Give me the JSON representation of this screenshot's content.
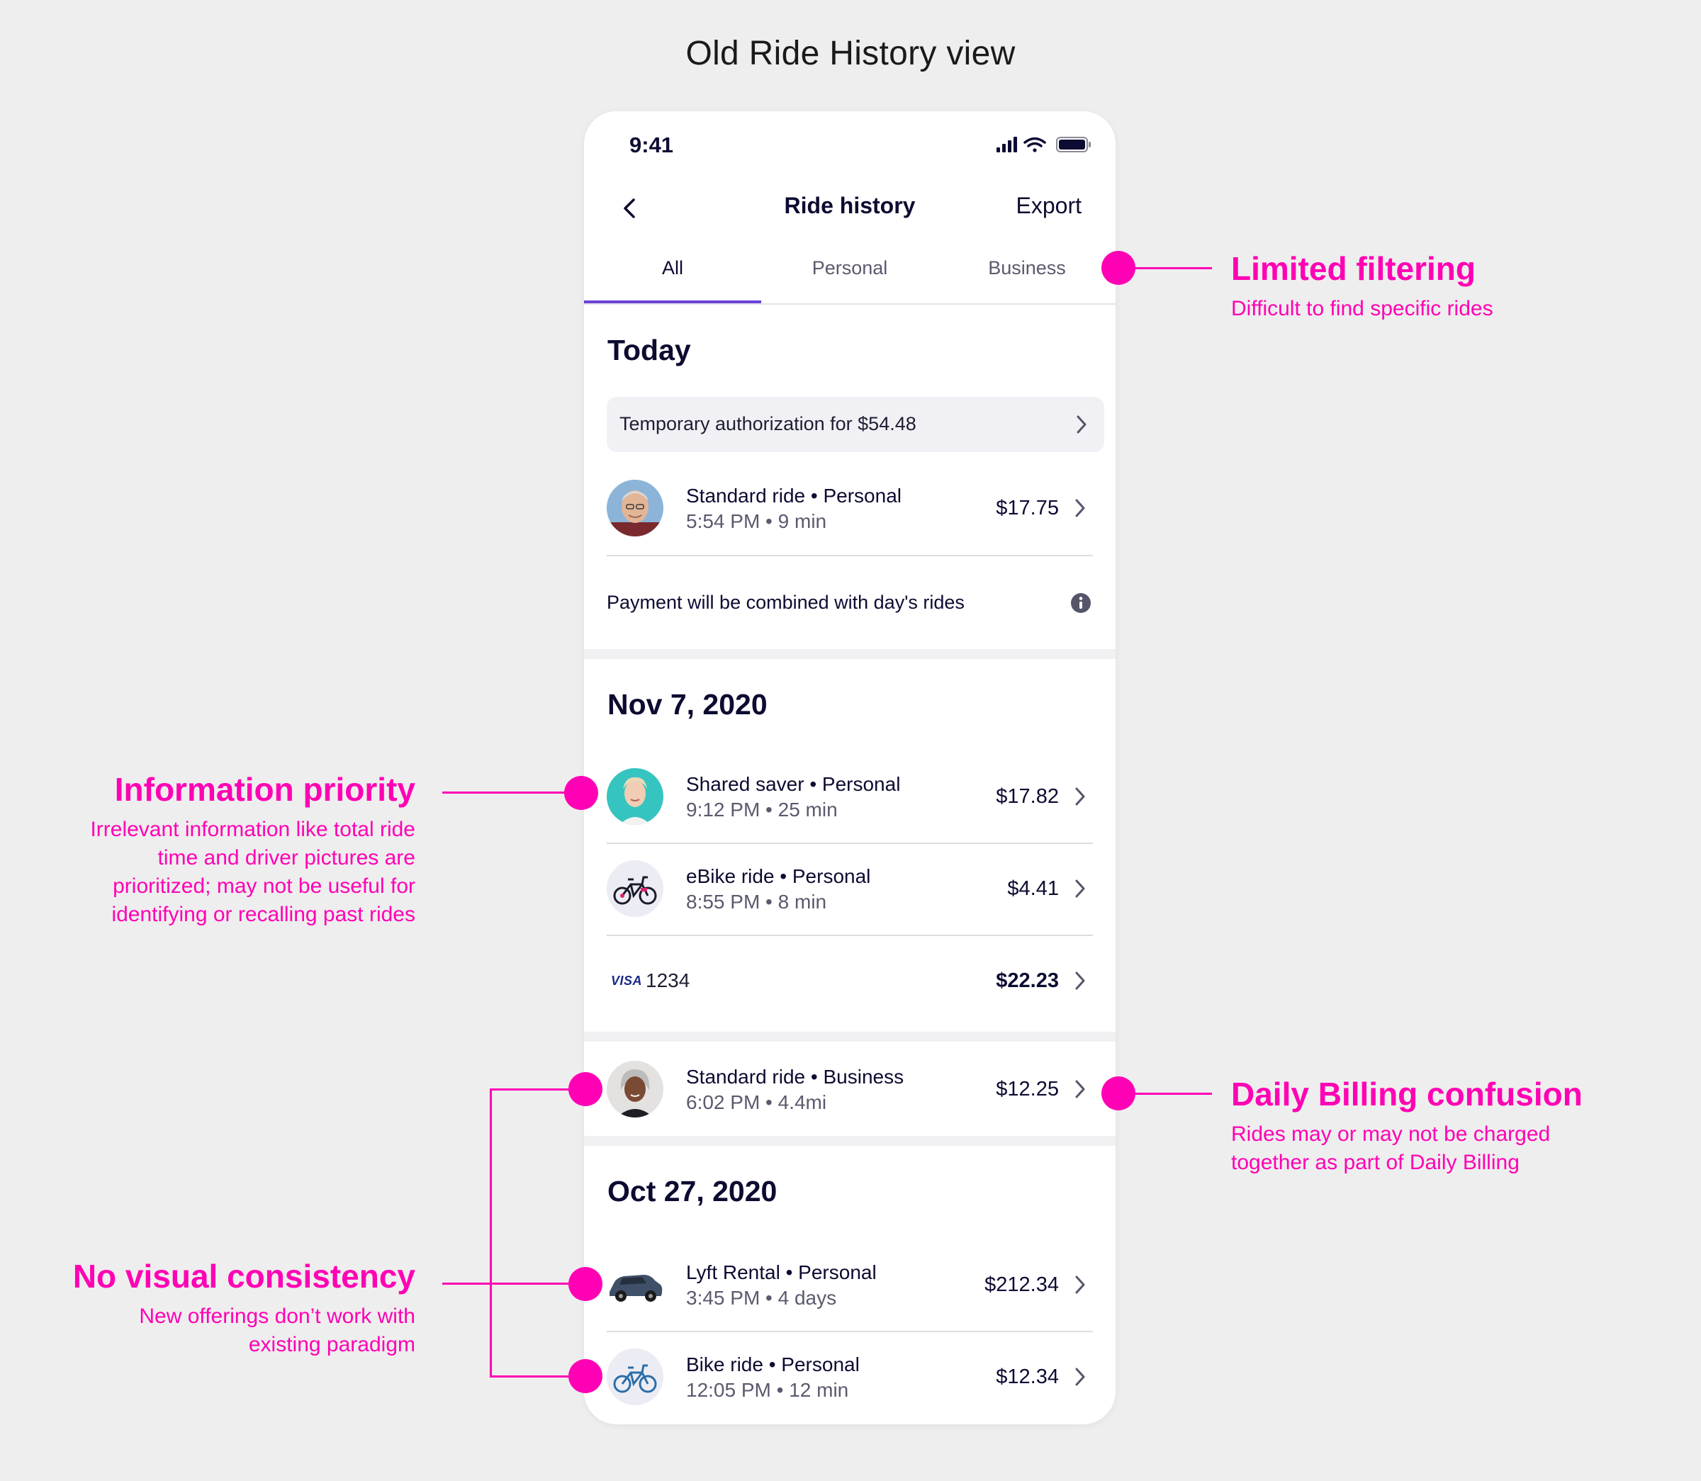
{
  "page_title": "Old Ride History view",
  "status_bar": {
    "time": "9:41"
  },
  "nav": {
    "title": "Ride history",
    "export_label": "Export"
  },
  "tabs": [
    {
      "label": "All",
      "active": true
    },
    {
      "label": "Personal",
      "active": false
    },
    {
      "label": "Business",
      "active": false
    }
  ],
  "sections": {
    "today": {
      "heading": "Today",
      "authorization": "Temporary authorization for $54.48",
      "rides": [
        {
          "title": "Standard ride • Personal",
          "subtitle": "5:54 PM • 9 min",
          "price": "$17.75",
          "thumb": "driver-photo"
        }
      ],
      "note": "Payment will be combined with day's rides"
    },
    "nov7": {
      "heading": "Nov 7, 2020",
      "rides": [
        {
          "title": "Shared saver • Personal",
          "subtitle": "9:12 PM • 25 min",
          "price": "$17.82",
          "thumb": "driver-photo"
        },
        {
          "title": "eBike ride • Personal",
          "subtitle": "8:55 PM • 8 min",
          "price": "$4.41",
          "thumb": "ebike-icon"
        }
      ],
      "payment": {
        "card_brand": "VISA",
        "card_last4": "1234",
        "total": "$22.23"
      },
      "business_ride": {
        "title": "Standard ride • Business",
        "subtitle": "6:02 PM • 4.4mi",
        "price": "$12.25",
        "thumb": "driver-photo"
      }
    },
    "oct27": {
      "heading": "Oct 27, 2020",
      "rides": [
        {
          "title": "Lyft Rental • Personal",
          "subtitle": "3:45 PM • 4 days",
          "price": "$212.34",
          "thumb": "car-icon"
        },
        {
          "title": "Bike ride • Personal",
          "subtitle": "12:05 PM • 12 min",
          "price": "$12.34",
          "thumb": "bike-icon"
        }
      ]
    }
  },
  "annotations": {
    "limited_filtering": {
      "title": "Limited filtering",
      "text": "Difficult to find specific rides"
    },
    "information_priority": {
      "title": "Information priority",
      "lines": [
        "Irrelevant information like total ride",
        "time and driver pictures are",
        "prioritized; may not be useful for",
        "identifying or recalling past rides"
      ]
    },
    "daily_billing": {
      "title": "Daily Billing confusion",
      "lines": [
        "Rides may or may not be charged",
        "together as part of Daily Billing"
      ]
    },
    "visual_consistency": {
      "title": "No visual consistency",
      "lines": [
        "New offerings don’t work with",
        "existing paradigm"
      ]
    }
  },
  "colors": {
    "annotation": "#ff00b4",
    "tab_accent": "#6b42d8",
    "text_primary": "#0c0b31",
    "background": "#eeeeee"
  }
}
